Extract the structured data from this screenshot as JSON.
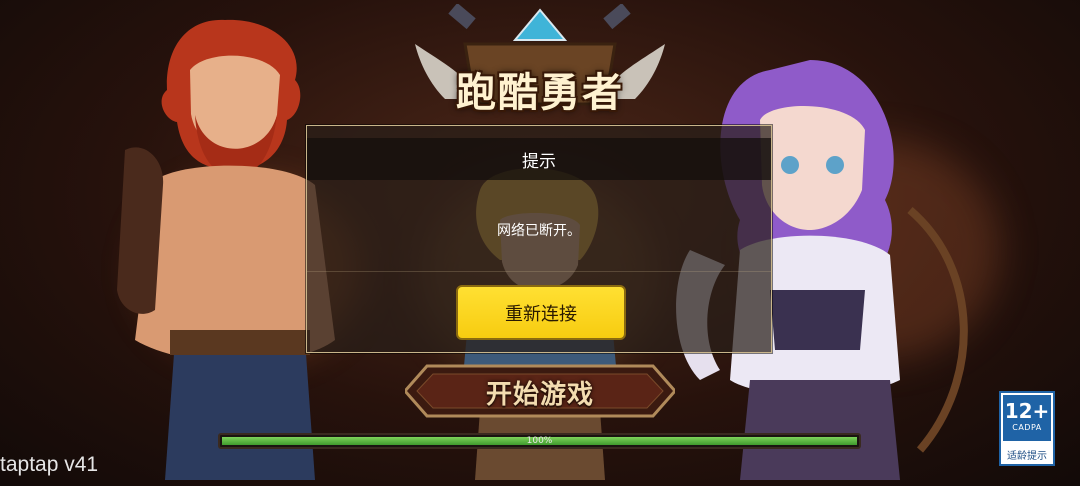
{
  "game": {
    "logo_text": "跑酷勇者"
  },
  "dialog": {
    "title": "提示",
    "message": "网络已断开。",
    "reconnect_label": "重新连接"
  },
  "start": {
    "label": "开始游戏"
  },
  "loading": {
    "progress_percent": 100,
    "progress_text": "100%"
  },
  "footer": {
    "version_text": "taptap v41"
  },
  "age_rating": {
    "age": "12+",
    "org": "CADPA",
    "caption": "适龄提示"
  },
  "colors": {
    "button_yellow": "#f7cc10",
    "progress_green": "#5fbf44",
    "badge_blue": "#1f63a6"
  }
}
